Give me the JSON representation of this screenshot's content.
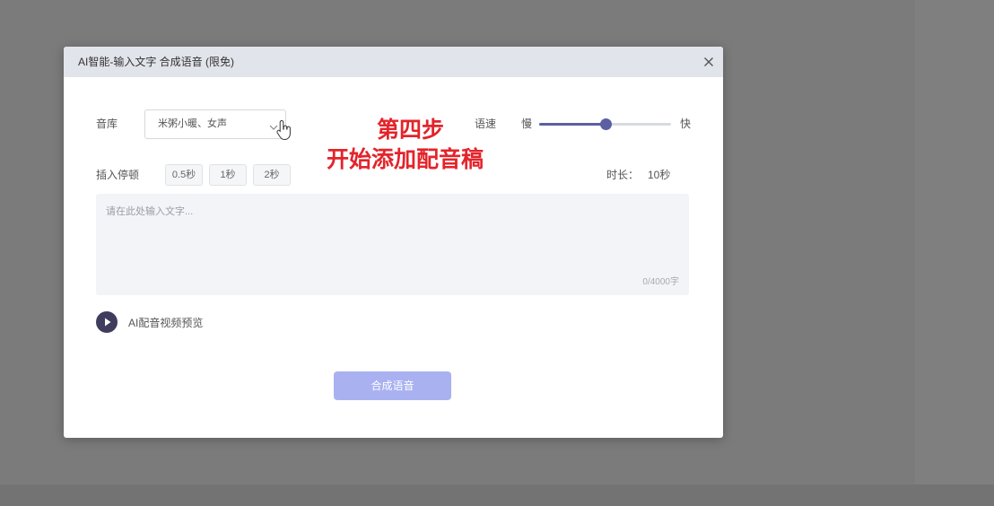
{
  "window": {
    "title": "AI智能-输入文字 合成语音 (限免)"
  },
  "voice": {
    "label": "音库",
    "selected": "米粥小暖、女声"
  },
  "speed": {
    "label": "语速",
    "slow": "慢",
    "fast": "快",
    "level": 0.5
  },
  "pause": {
    "label": "插入停顿",
    "options": [
      "0.5秒",
      "1秒",
      "2秒"
    ]
  },
  "duration": {
    "label": "时长：",
    "value": "10秒"
  },
  "text_input": {
    "placeholder": "请在此处输入文字...",
    "counter": "0/4000字"
  },
  "preview": {
    "label": "AI配音视频预览"
  },
  "submit": {
    "label": "合成语音"
  },
  "annotation": {
    "line1": "第四步",
    "line2": "开始添加配音稿"
  },
  "icons": {
    "close": "close-icon",
    "dropdown": "chevron-down-icon",
    "cursor": "hand-cursor-icon",
    "play": "play-icon"
  },
  "colors": {
    "accent": "#5c5fa3",
    "submit_button": "#a9b1f1",
    "annotation": "#e3242b",
    "header": "#e2e4eb"
  }
}
